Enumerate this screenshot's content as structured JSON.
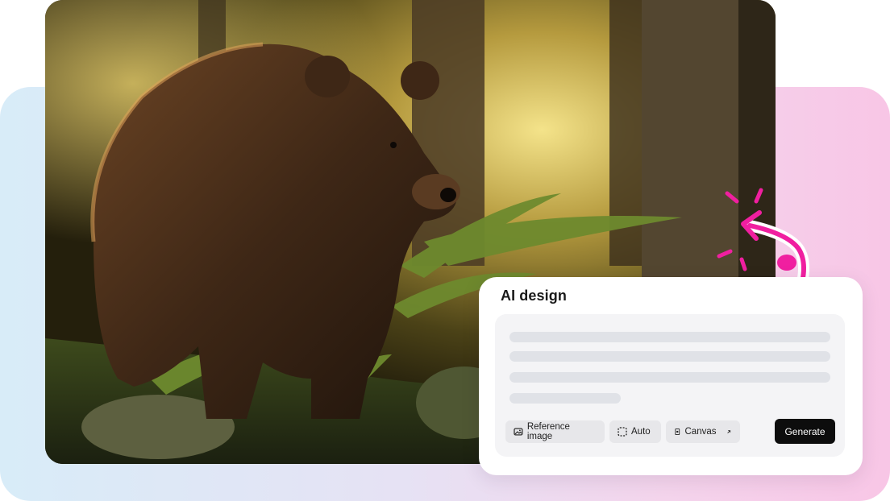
{
  "colors": {
    "accent_pink": "#f01fa0",
    "generate_bg": "#0d0d0d",
    "card_bg": "#ffffff",
    "chip_bg": "#e7e7ea"
  },
  "photo": {
    "subject": "brown bear in forest"
  },
  "ai_panel": {
    "title": "AI design",
    "prompt_placeholder_lines": 4,
    "toolbar": {
      "reference_image": {
        "label": "Reference image",
        "icon": "image-icon"
      },
      "auto": {
        "label": "Auto",
        "icon": "dashed-square-icon"
      },
      "canvas": {
        "label": "Canvas",
        "icon": "canvas-icon",
        "trailing_icon": "arrow-up-right-icon"
      },
      "generate_label": "Generate"
    }
  },
  "decoration": {
    "icon": "curved-arrow-icon",
    "sparkles": "sparkle-burst-icon"
  }
}
